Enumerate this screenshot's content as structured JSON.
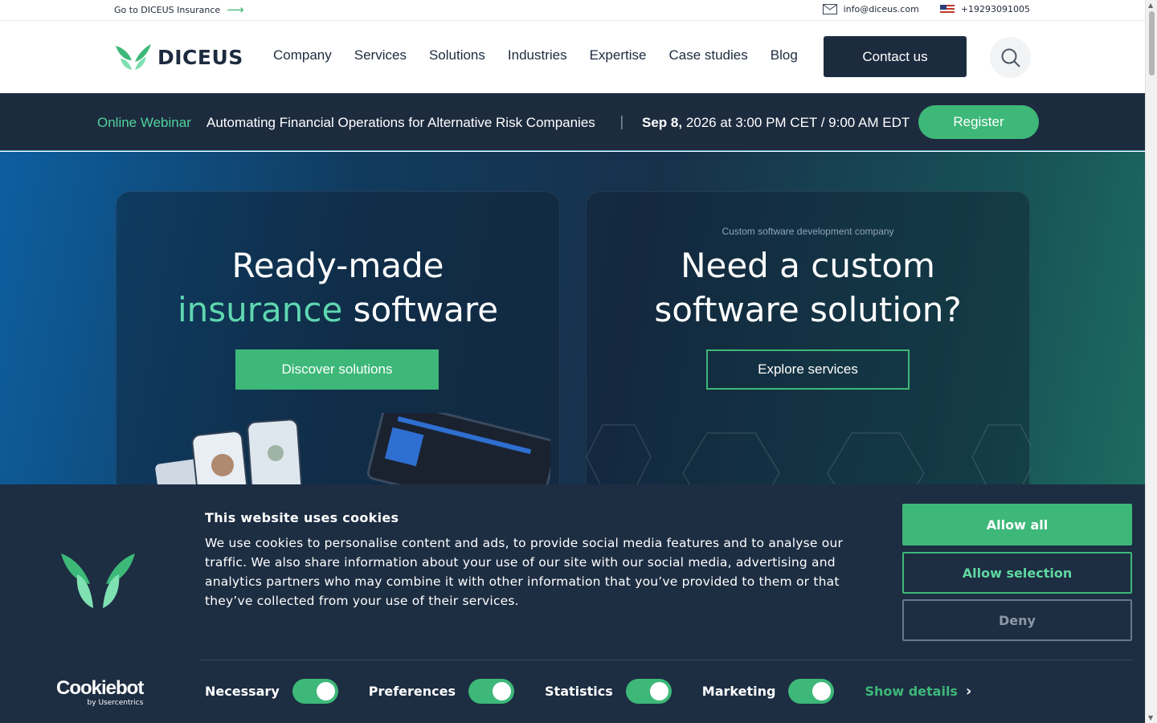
{
  "topbar": {
    "goto_label": "Go to DICEUS Insurance",
    "email": "info@diceus.com",
    "phone": "+19293091005",
    "icons": [
      "arrow-right-icon",
      "mail-icon",
      "us-flag-icon"
    ]
  },
  "header": {
    "logo_text": "DICEUS",
    "nav": [
      "Company",
      "Services",
      "Solutions",
      "Industries",
      "Expertise",
      "Case studies",
      "Blog"
    ],
    "contact_label": "Contact us",
    "search_icon": "search-icon"
  },
  "webinar": {
    "label": "Online Webinar",
    "title": "Automating Financial Operations for Alternative Risk Companies",
    "separator": "|",
    "date_bold": "Sep 8,",
    "date_rest": " 2026 at 3:00 PM CET / 9:00 AM EDT",
    "register_label": "Register"
  },
  "hero": {
    "left": {
      "line1": "Ready-made",
      "accent": "insurance",
      "rest": " software",
      "button": "Discover solutions"
    },
    "right": {
      "kicker": "Custom software development company",
      "line1": "Need a custom",
      "line2": "software solution?",
      "button": "Explore services"
    }
  },
  "cookie": {
    "title": "This website uses cookies",
    "text": "We use cookies to personalise content and ads, to provide social media features and to analyse our traffic. We also share information about your use of our site with our social media, advertising and analytics partners who may combine it with other information that you’ve provided to them or that they’ve collected from your use of their services.",
    "brand": "Cookiebot",
    "brand_sub": "by Usercentrics",
    "allow_all": "Allow all",
    "allow_selection": "Allow selection",
    "deny": "Deny",
    "toggles": [
      {
        "label": "Necessary",
        "on": true
      },
      {
        "label": "Preferences",
        "on": true
      },
      {
        "label": "Statistics",
        "on": true
      },
      {
        "label": "Marketing",
        "on": true
      }
    ],
    "show_details": "Show details"
  },
  "colors": {
    "navy": "#1d2b3f",
    "green": "#3db878",
    "accent_teal": "#5fd7b0",
    "cookie_bg": "#1d2d42"
  }
}
